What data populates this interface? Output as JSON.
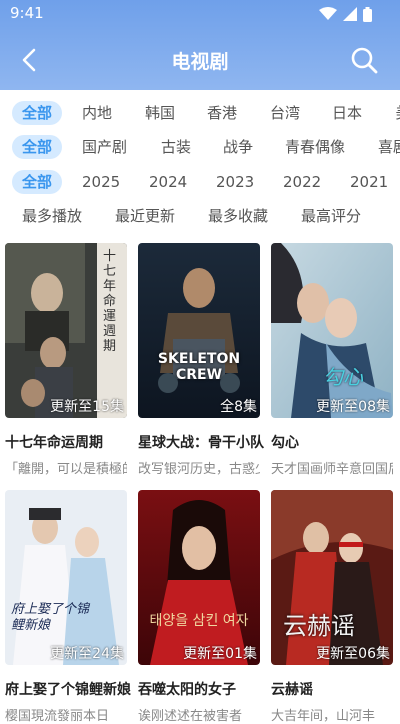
{
  "status": {
    "time": "9:41"
  },
  "header": {
    "title": "电视剧"
  },
  "filters": {
    "region": [
      "全部",
      "内地",
      "韩国",
      "香港",
      "台湾",
      "日本",
      "美"
    ],
    "genre": [
      "全部",
      "国产剧",
      "古装",
      "战争",
      "青春偶像",
      "喜剧"
    ],
    "year": [
      "全部",
      "2025",
      "2024",
      "2023",
      "2022",
      "2021"
    ],
    "sort": [
      "最多播放",
      "最近更新",
      "最多收藏",
      "最高评分"
    ]
  },
  "items": [
    {
      "title": "十七年命运周期",
      "desc": "「離開，可以是積極的",
      "badge": "更新至15集",
      "poster_text": "十七年命運週期"
    },
    {
      "title": "星球大战：骨干小队",
      "desc": "改写银河历史，古惑少年",
      "badge": "全8集",
      "poster_text": "SKELETON CREW"
    },
    {
      "title": "勾心",
      "desc": "天才国画师辛意回国后",
      "badge": "更新至08集",
      "poster_text": "勾心"
    },
    {
      "title": "府上娶了个锦鲤新娘",
      "desc": "樱国現流發丽本日",
      "badge": "更新至24集",
      "poster_text": "府上娶了个锦鲤新娘"
    },
    {
      "title": "吞噬太阳的女子",
      "desc": "诶刚述述在被害者",
      "badge": "更新至01集",
      "poster_text": "태양을 삼킨 여자"
    },
    {
      "title": "云赫谣",
      "desc": "大吉年间，山河丰",
      "badge": "更新至06集",
      "poster_text": "云赫谣"
    }
  ]
}
